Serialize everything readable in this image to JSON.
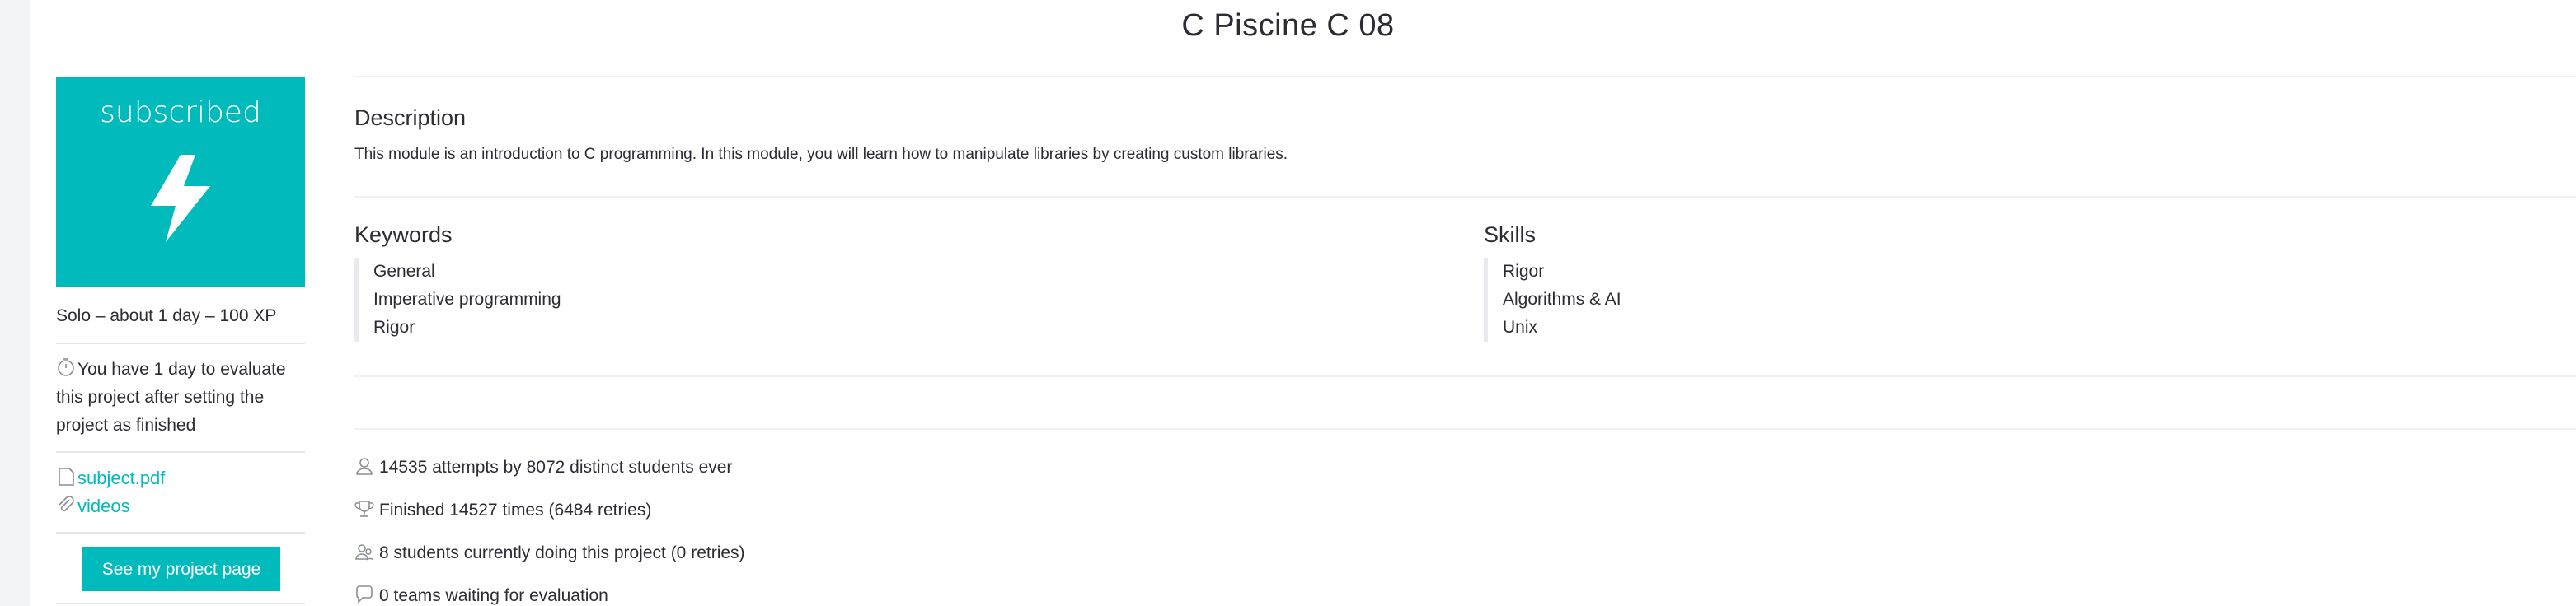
{
  "page": {
    "title": "C Piscine C 08"
  },
  "sidebar": {
    "status": "subscribed",
    "status_icon": "bolt-icon",
    "meta": "Solo – about 1 day – 100 XP",
    "eval_note": "You have 1 day to evaluate this project after setting the project as finished",
    "links": [
      {
        "label": "subject.pdf",
        "icon": "document-icon"
      },
      {
        "label": "videos",
        "icon": "paperclip-icon"
      }
    ],
    "project_button": "See my project page"
  },
  "description": {
    "heading": "Description",
    "text": "This module is an introduction to C programming. In this module, you will learn how to manipulate libraries by creating custom libraries."
  },
  "keywords": {
    "heading": "Keywords",
    "items": [
      "General",
      "Imperative programming",
      "Rigor"
    ]
  },
  "skills": {
    "heading": "Skills",
    "items": [
      "Rigor",
      "Algorithms & AI",
      "Unix"
    ]
  },
  "stats": [
    {
      "icon": "user-icon",
      "text": "14535 attempts by 8072 distinct students ever"
    },
    {
      "icon": "trophy-icon",
      "text": "Finished 14527 times (6484 retries)"
    },
    {
      "icon": "users-icon",
      "text": "8 students currently doing this project (0 retries)"
    },
    {
      "icon": "chat-icon",
      "text": "0 teams waiting for evaluation"
    }
  ],
  "colors": {
    "accent": "#00babc",
    "text": "#2c2c34",
    "divider": "#eef0f2"
  }
}
